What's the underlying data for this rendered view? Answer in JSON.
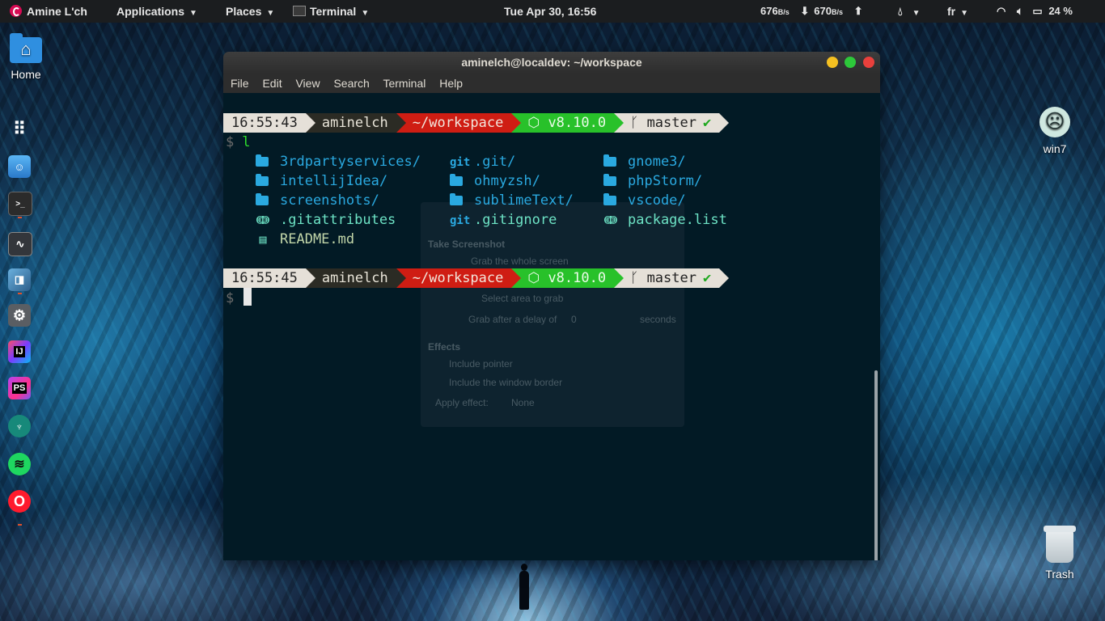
{
  "topbar": {
    "user": "Amine L'ch",
    "applications": "Applications",
    "places": "Places",
    "terminal": "Terminal",
    "clock": "Tue Apr 30, 16:56",
    "net_down_value": "676",
    "net_down_unit": "B/s",
    "net_up_value": "670",
    "net_up_unit": "B/s",
    "keyboard_layout": "fr",
    "battery": "24 %"
  },
  "desktop": {
    "home_label": "Home",
    "win7_label": "win7",
    "trash_label": "Trash"
  },
  "dock": {
    "items": [
      {
        "name": "app-grid",
        "glyph": "⠿"
      },
      {
        "name": "files",
        "glyph": ""
      },
      {
        "name": "terminal",
        "glyph": ">_"
      },
      {
        "name": "system-monitor",
        "glyph": "⚡"
      },
      {
        "name": "screenshot",
        "glyph": ""
      },
      {
        "name": "settings",
        "glyph": "⚙"
      },
      {
        "name": "intellij",
        "glyph": "IJ"
      },
      {
        "name": "phpstorm",
        "glyph": "PS"
      },
      {
        "name": "gitkraken",
        "glyph": "♆"
      },
      {
        "name": "spotify",
        "glyph": "≋"
      },
      {
        "name": "opera",
        "glyph": "O"
      }
    ]
  },
  "terminal": {
    "title": "aminelch@localdev: ~/workspace",
    "menu": [
      "File",
      "Edit",
      "View",
      "Search",
      "Terminal",
      "Help"
    ],
    "prompt1": {
      "time": "16:55:43",
      "user": "aminelch",
      "dir": "~/workspace",
      "node": "⬡ v8.10.0",
      "git_icon": "ᚴ",
      "branch": "master",
      "status": "✔"
    },
    "prompt2": {
      "time": "16:55:45",
      "user": "aminelch",
      "dir": "~/workspace",
      "node": "⬡ v8.10.0",
      "git_icon": "ᚴ",
      "branch": "master",
      "status": "✔"
    },
    "dollar": "$",
    "command": "l",
    "listing": [
      {
        "icon": "folder",
        "name": "3rdpartyservices/"
      },
      {
        "icon": "git",
        "name": ".git/"
      },
      {
        "icon": "folder",
        "name": "gnome3/"
      },
      {
        "icon": "folder",
        "name": "intellijIdea/"
      },
      {
        "icon": "folder",
        "name": "ohmyzsh/"
      },
      {
        "icon": "folder",
        "name": "phpStorm/"
      },
      {
        "icon": "folder",
        "name": "screenshots/"
      },
      {
        "icon": "folder",
        "name": "sublimeText/"
      },
      {
        "icon": "folder",
        "name": "vscode/"
      },
      {
        "icon": "config",
        "name": ".gitattributes"
      },
      {
        "icon": "git",
        "name": ".gitignore"
      },
      {
        "icon": "config",
        "name": "package.list"
      },
      {
        "icon": "markdown",
        "name": "README.md"
      }
    ],
    "git_glyph": "git",
    "config_glyph": "ↈ",
    "md_glyph": "▤"
  },
  "ghost_dialog": {
    "title": "Take Screenshot",
    "opt1": "Grab the whole screen",
    "opt2": "Select area to grab",
    "delay_label": "Grab after a delay of",
    "delay_value": "0",
    "delay_unit": "seconds",
    "effects": "Effects",
    "pointer": "Include pointer",
    "border": "Include the window border",
    "apply": "Apply effect:",
    "apply_value": "None"
  },
  "colors": {
    "accent_red": "#cf1d13",
    "accent_green": "#28c12a",
    "folder_blue": "#2aa9e0"
  }
}
